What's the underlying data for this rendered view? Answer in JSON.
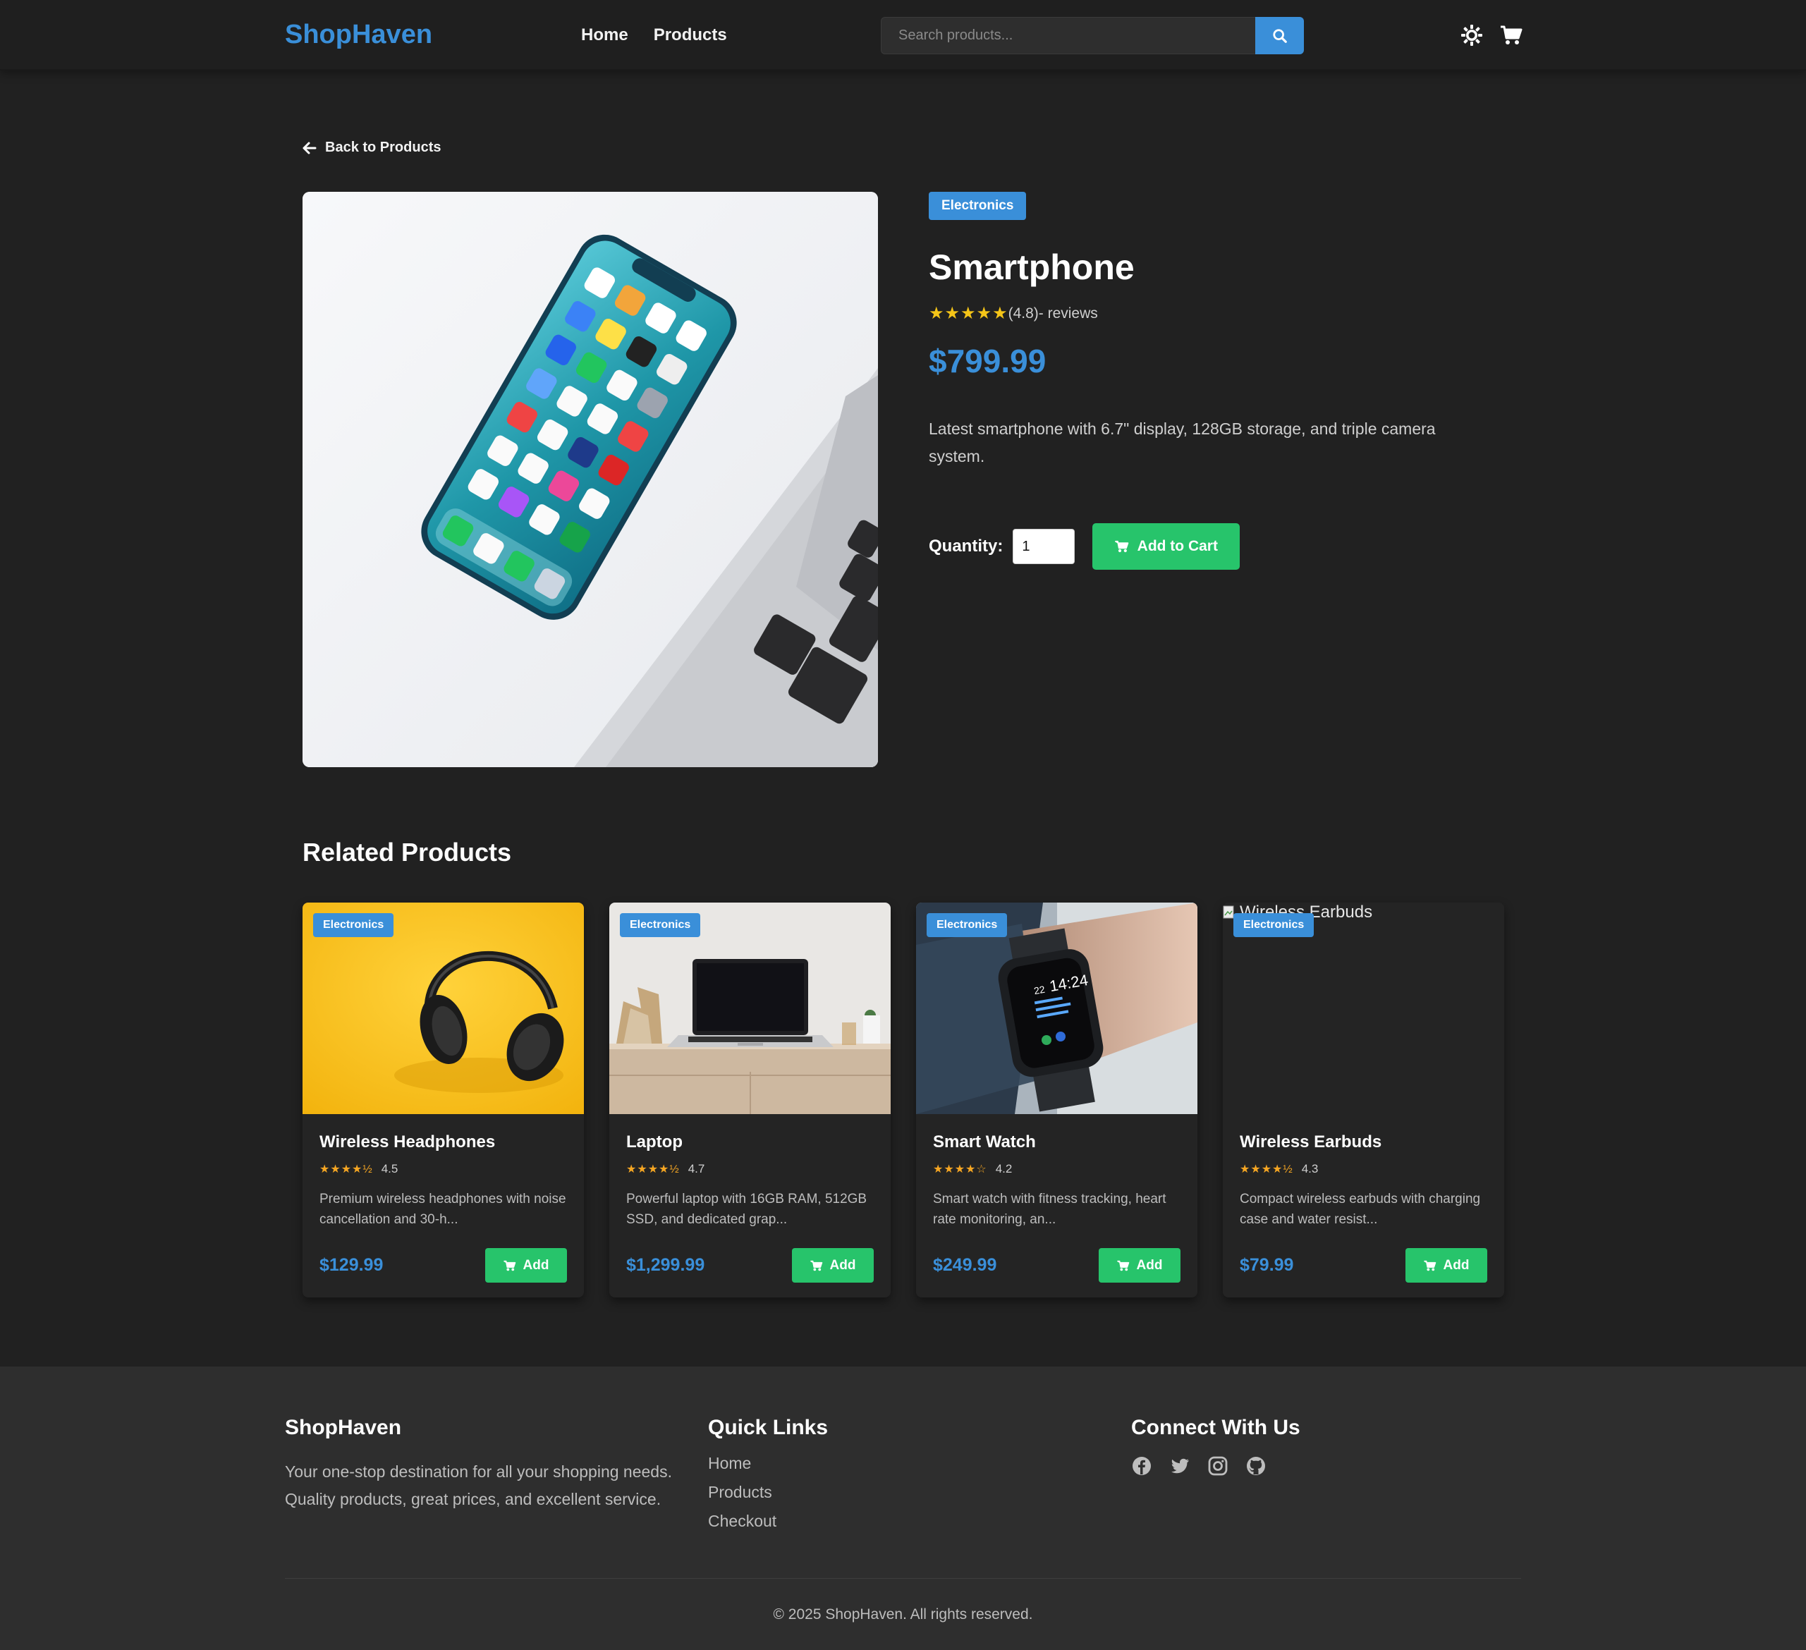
{
  "navbar": {
    "brand": "ShopHaven",
    "links": [
      "Home",
      "Products"
    ],
    "search_placeholder": "Search products..."
  },
  "product": {
    "back_label": "Back to Products",
    "category": "Electronics",
    "title": "Smartphone",
    "stars": "★★★★★",
    "rating_text": "(4.8)",
    "reviews_text": " - reviews",
    "price": "$799.99",
    "description": "Latest smartphone with 6.7\" display, 128GB storage, and triple camera system.",
    "quantity_label": "Quantity:",
    "quantity_value": "1",
    "add_to_cart_label": "Add to Cart"
  },
  "related": {
    "title": "Related Products",
    "items": [
      {
        "category": "Electronics",
        "name": "Wireless Headphones",
        "stars": "★★★★½",
        "rating": "4.5",
        "description": "Premium wireless headphones with noise cancellation and 30-h...",
        "price": "$129.99",
        "add_label": "Add"
      },
      {
        "category": "Electronics",
        "name": "Laptop",
        "stars": "★★★★½",
        "rating": "4.7",
        "description": "Powerful laptop with 16GB RAM, 512GB SSD, and dedicated grap...",
        "price": "$1,299.99",
        "add_label": "Add"
      },
      {
        "category": "Electronics",
        "name": "Smart Watch",
        "stars": "★★★★☆",
        "rating": "4.2",
        "description": "Smart watch with fitness tracking, heart rate monitoring, an...",
        "price": "$249.99",
        "add_label": "Add"
      },
      {
        "category": "Electronics",
        "name": "Wireless Earbuds",
        "stars": "★★★★½",
        "rating": "4.3",
        "description": "Compact wireless earbuds with charging case and water resist...",
        "price": "$79.99",
        "add_label": "Add",
        "broken_alt": "Wireless Earbuds"
      }
    ]
  },
  "watch_face": {
    "date": "22",
    "time": "14:24"
  },
  "footer": {
    "about_title": "ShopHaven",
    "about_text": "Your one-stop destination for all your shopping needs. Quality products, great prices, and excellent service.",
    "links_title": "Quick Links",
    "links": [
      "Home",
      "Products",
      "Checkout"
    ],
    "social_title": "Connect With Us",
    "social_icons": [
      "facebook-icon",
      "twitter-icon",
      "instagram-icon",
      "github-icon"
    ],
    "copyright": "© 2025 ShopHaven. All rights reserved."
  },
  "colors": {
    "accent": "#3a8fd9",
    "success": "#27c46b",
    "star": "#f5c518",
    "background": "#212121"
  }
}
